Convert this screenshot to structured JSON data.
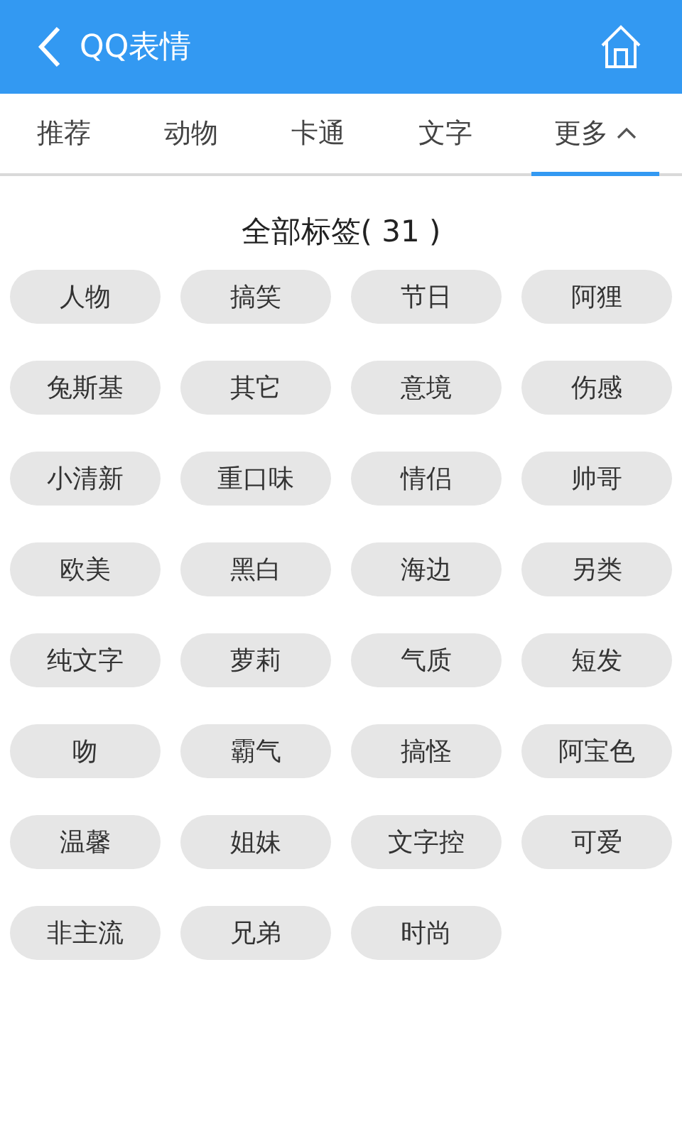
{
  "header": {
    "title": "QQ表情"
  },
  "tabs": [
    {
      "label": "推荐",
      "selected": false
    },
    {
      "label": "动物",
      "selected": false
    },
    {
      "label": "卡通",
      "selected": false
    },
    {
      "label": "文字",
      "selected": false
    },
    {
      "label": "更多",
      "selected": true,
      "expanded": true
    }
  ],
  "tags_panel": {
    "title": "全部标签( 31 )",
    "tags": [
      "人物",
      "搞笑",
      "节日",
      "阿狸",
      "兔斯基",
      "其它",
      "意境",
      "伤感",
      "小清新",
      "重口味",
      "情侣",
      "帅哥",
      "欧美",
      "黑白",
      "海边",
      "另类",
      "纯文字",
      "萝莉",
      "气质",
      "短发",
      "吻",
      "霸气",
      "搞怪",
      "阿宝色",
      "温馨",
      "姐妹",
      "文字控",
      "可爱",
      "非主流",
      "兄弟",
      "时尚"
    ]
  }
}
